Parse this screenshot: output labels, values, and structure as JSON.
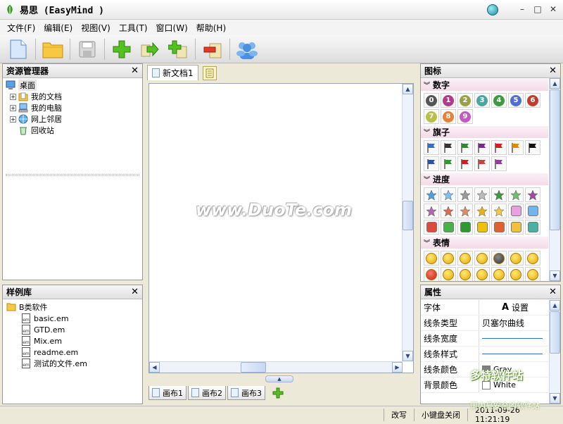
{
  "window": {
    "title": "易思 (EasyMind )"
  },
  "menu": [
    "文件(F)",
    "编辑(E)",
    "视图(V)",
    "工具(T)",
    "窗口(W)",
    "帮助(H)"
  ],
  "toolbar": [
    "new-document-icon",
    "open-folder-icon",
    "save-icon",
    "add-node-icon",
    "add-sibling-icon",
    "add-child-icon",
    "delete-node-icon",
    "delete-page-icon",
    "members-icon"
  ],
  "explorer": {
    "title": "资源管理器",
    "root": "桌面",
    "items": [
      "我的文档",
      "我的电脑",
      "网上邻居",
      "回收站"
    ]
  },
  "samples": {
    "title": "样例库",
    "folder": "B类软件",
    "files": [
      "basic.em",
      "GTD.em",
      "Mix.em",
      "readme.em",
      "测试的文件.em"
    ]
  },
  "editor": {
    "tab": "新文档1",
    "watermark": "www.DuoTe.com",
    "canvas_tabs": [
      "画布1",
      "画布2",
      "画布3"
    ]
  },
  "icons_panel": {
    "title": "图标",
    "sections": {
      "numbers": "数字",
      "flags": "旗子",
      "progress": "进度",
      "faces": "表情"
    },
    "numbers": [
      "0",
      "1",
      "2",
      "3",
      "4",
      "5",
      "6",
      "7",
      "8",
      "9"
    ]
  },
  "properties": {
    "title": "属性",
    "font_label": "字体",
    "font_button": "设置",
    "line_type_label": "线条类型",
    "line_type_value": "贝塞尔曲线",
    "line_width_label": "线条宽度",
    "line_style_label": "线条样式",
    "line_color_label": "线条颜色",
    "line_color_value": "Gray",
    "bg_color_label": "背景颜色",
    "bg_color_value": "White"
  },
  "status": {
    "mode": "改写",
    "keyboard": "小键盘关闭",
    "datetime": "2011-09-26 11:21:19"
  },
  "watermark_brand": "多特软件站",
  "watermark_slogan": "国内最安全的软件站",
  "colors": {
    "accent": "#2a6fd6",
    "panel_border": "#999999",
    "section_bg": "#f3dbe8"
  }
}
